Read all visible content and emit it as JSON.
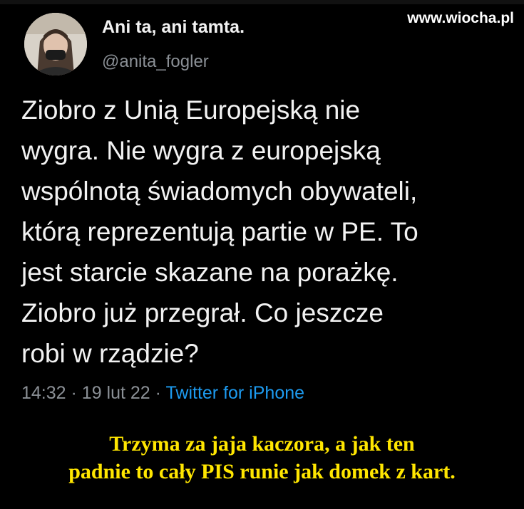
{
  "watermark": "www.wiocha.pl",
  "tweet": {
    "author_name": "Ani ta, ani tamta.",
    "author_handle": "@anita_fogler",
    "text_lines": [
      "Ziobro z Unią Europejską nie",
      "wygra. Nie wygra z europejską",
      "wspólnotą świadomych obywateli,",
      "którą reprezentują partie w PE. To",
      "jest starcie skazane na porażkę.",
      "Ziobro już przegrał. Co jeszcze",
      "robi w rządzie?"
    ],
    "time": "14:32",
    "date": "19 lut 22",
    "separator": "·",
    "source": "Twitter for iPhone"
  },
  "caption": {
    "lines": [
      "Trzyma za jaja kaczora, a jak ten",
      "padnie to cały PIS runie jak domek z kart."
    ]
  }
}
